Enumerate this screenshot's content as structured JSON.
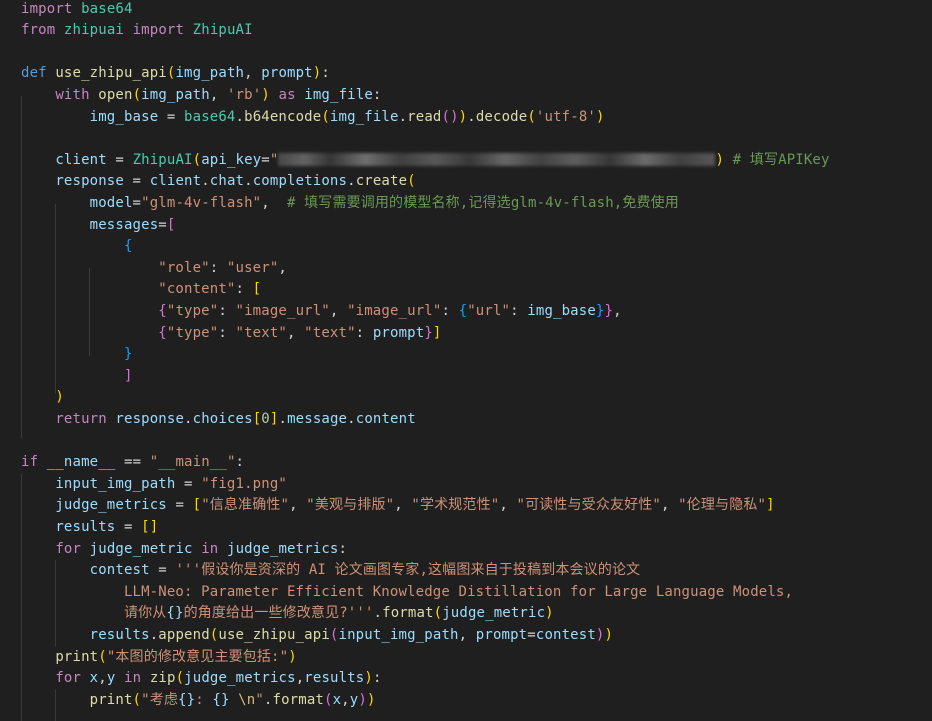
{
  "editor": {
    "language": "python",
    "lines": [
      {
        "tokens": [
          [
            "kw",
            "import"
          ],
          [
            "op",
            " "
          ],
          [
            "cls",
            "base64"
          ]
        ]
      },
      {
        "tokens": [
          [
            "kw",
            "from"
          ],
          [
            "op",
            " "
          ],
          [
            "cls",
            "zhipuai"
          ],
          [
            "op",
            " "
          ],
          [
            "kw",
            "import"
          ],
          [
            "op",
            " "
          ],
          [
            "cls",
            "ZhipuAI"
          ]
        ]
      },
      {
        "tokens": []
      },
      {
        "tokens": [
          [
            "kwb",
            "def"
          ],
          [
            "op",
            " "
          ],
          [
            "fn",
            "use_zhipu_api"
          ],
          [
            "b1",
            "("
          ],
          [
            "var",
            "img_path"
          ],
          [
            "op",
            ", "
          ],
          [
            "var",
            "prompt"
          ],
          [
            "b1",
            ")"
          ],
          [
            "op",
            ":"
          ]
        ]
      },
      {
        "tokens": [
          [
            "op",
            "    "
          ],
          [
            "kw",
            "with"
          ],
          [
            "op",
            " "
          ],
          [
            "fn",
            "open"
          ],
          [
            "b1",
            "("
          ],
          [
            "var",
            "img_path"
          ],
          [
            "op",
            ", "
          ],
          [
            "str",
            "'rb'"
          ],
          [
            "b1",
            ")"
          ],
          [
            "op",
            " "
          ],
          [
            "kw",
            "as"
          ],
          [
            "op",
            " "
          ],
          [
            "var",
            "img_file"
          ],
          [
            "op",
            ":"
          ]
        ]
      },
      {
        "tokens": [
          [
            "op",
            "        "
          ],
          [
            "var",
            "img_base"
          ],
          [
            "op",
            " = "
          ],
          [
            "cls",
            "base64"
          ],
          [
            "op",
            "."
          ],
          [
            "fn",
            "b64encode"
          ],
          [
            "b1",
            "("
          ],
          [
            "var",
            "img_file"
          ],
          [
            "op",
            "."
          ],
          [
            "fn",
            "read"
          ],
          [
            "b2",
            "()"
          ],
          [
            "b1",
            ")"
          ],
          [
            "op",
            "."
          ],
          [
            "fn",
            "decode"
          ],
          [
            "b1",
            "("
          ],
          [
            "str",
            "'utf-8'"
          ],
          [
            "b1",
            ")"
          ]
        ]
      },
      {
        "tokens": []
      },
      {
        "tokens": [
          [
            "op",
            "    "
          ],
          [
            "var",
            "client"
          ],
          [
            "op",
            " = "
          ],
          [
            "cls",
            "ZhipuAI"
          ],
          [
            "b1",
            "("
          ],
          [
            "var",
            "api_key"
          ],
          [
            "op",
            "="
          ],
          [
            "str",
            "\""
          ],
          [
            "blur",
            ""
          ],
          [
            "b1",
            ")"
          ],
          [
            "op",
            " "
          ],
          [
            "cmt",
            "# 填写APIKey"
          ]
        ]
      },
      {
        "tokens": [
          [
            "op",
            "    "
          ],
          [
            "var",
            "response"
          ],
          [
            "op",
            " = "
          ],
          [
            "var",
            "client"
          ],
          [
            "op",
            "."
          ],
          [
            "var",
            "chat"
          ],
          [
            "op",
            "."
          ],
          [
            "var",
            "completions"
          ],
          [
            "op",
            "."
          ],
          [
            "fn",
            "create"
          ],
          [
            "b1",
            "("
          ]
        ]
      },
      {
        "tokens": [
          [
            "op",
            "        "
          ],
          [
            "var",
            "model"
          ],
          [
            "op",
            "="
          ],
          [
            "str",
            "\"glm-4v-flash\""
          ],
          [
            "op",
            ",  "
          ],
          [
            "cmt",
            "# 填写需要调用的模型名称,记得选glm-4v-flash,免费使用"
          ]
        ]
      },
      {
        "tokens": [
          [
            "op",
            "        "
          ],
          [
            "var",
            "messages"
          ],
          [
            "op",
            "="
          ],
          [
            "b2",
            "["
          ]
        ]
      },
      {
        "tokens": [
          [
            "op",
            "            "
          ],
          [
            "b3",
            "{"
          ]
        ]
      },
      {
        "tokens": [
          [
            "op",
            "                "
          ],
          [
            "str",
            "\"role\""
          ],
          [
            "op",
            ": "
          ],
          [
            "str",
            "\"user\""
          ],
          [
            "op",
            ","
          ]
        ]
      },
      {
        "tokens": [
          [
            "op",
            "                "
          ],
          [
            "str",
            "\"content\""
          ],
          [
            "op",
            ": "
          ],
          [
            "b1",
            "["
          ]
        ]
      },
      {
        "tokens": [
          [
            "op",
            "                "
          ],
          [
            "b2",
            "{"
          ],
          [
            "str",
            "\"type\""
          ],
          [
            "op",
            ": "
          ],
          [
            "str",
            "\"image_url\""
          ],
          [
            "op",
            ", "
          ],
          [
            "str",
            "\"image_url\""
          ],
          [
            "op",
            ": "
          ],
          [
            "b3",
            "{"
          ],
          [
            "str",
            "\"url\""
          ],
          [
            "op",
            ": "
          ],
          [
            "var",
            "img_base"
          ],
          [
            "b3",
            "}"
          ],
          [
            "b2",
            "}"
          ],
          [
            "op",
            ","
          ]
        ]
      },
      {
        "tokens": [
          [
            "op",
            "                "
          ],
          [
            "b2",
            "{"
          ],
          [
            "str",
            "\"type\""
          ],
          [
            "op",
            ": "
          ],
          [
            "str",
            "\"text\""
          ],
          [
            "op",
            ", "
          ],
          [
            "str",
            "\"text\""
          ],
          [
            "op",
            ": "
          ],
          [
            "var",
            "prompt"
          ],
          [
            "b2",
            "}"
          ],
          [
            "b1",
            "]"
          ]
        ]
      },
      {
        "tokens": [
          [
            "op",
            "            "
          ],
          [
            "b3",
            "}"
          ]
        ]
      },
      {
        "tokens": [
          [
            "op",
            "            "
          ],
          [
            "b2",
            "]"
          ]
        ]
      },
      {
        "tokens": [
          [
            "op",
            "    "
          ],
          [
            "b1",
            ")"
          ]
        ]
      },
      {
        "tokens": [
          [
            "op",
            "    "
          ],
          [
            "kw",
            "return"
          ],
          [
            "op",
            " "
          ],
          [
            "var",
            "response"
          ],
          [
            "op",
            "."
          ],
          [
            "var",
            "choices"
          ],
          [
            "b1",
            "["
          ],
          [
            "num",
            "0"
          ],
          [
            "b1",
            "]"
          ],
          [
            "op",
            "."
          ],
          [
            "var",
            "message"
          ],
          [
            "op",
            "."
          ],
          [
            "var",
            "content"
          ]
        ]
      },
      {
        "tokens": []
      },
      {
        "tokens": [
          [
            "kw",
            "if"
          ],
          [
            "op",
            " "
          ],
          [
            "var",
            "__name__"
          ],
          [
            "op",
            " == "
          ],
          [
            "str",
            "\"__main__\""
          ],
          [
            "op",
            ":"
          ]
        ]
      },
      {
        "tokens": [
          [
            "op",
            "    "
          ],
          [
            "var",
            "input_img_path"
          ],
          [
            "op",
            " = "
          ],
          [
            "str",
            "\"fig1.png\""
          ]
        ]
      },
      {
        "tokens": [
          [
            "op",
            "    "
          ],
          [
            "var",
            "judge_metrics"
          ],
          [
            "op",
            " = "
          ],
          [
            "b1",
            "["
          ],
          [
            "str",
            "\"信息准确性\""
          ],
          [
            "op",
            ", "
          ],
          [
            "str",
            "\"美观与排版\""
          ],
          [
            "op",
            ", "
          ],
          [
            "str",
            "\"学术规范性\""
          ],
          [
            "op",
            ", "
          ],
          [
            "str",
            "\"可读性与受众友好性\""
          ],
          [
            "op",
            ", "
          ],
          [
            "str",
            "\"伦理与隐私\""
          ],
          [
            "b1",
            "]"
          ]
        ]
      },
      {
        "tokens": [
          [
            "op",
            "    "
          ],
          [
            "var",
            "results"
          ],
          [
            "op",
            " = "
          ],
          [
            "b1",
            "[]"
          ]
        ]
      },
      {
        "tokens": [
          [
            "op",
            "    "
          ],
          [
            "kw",
            "for"
          ],
          [
            "op",
            " "
          ],
          [
            "var",
            "judge_metric"
          ],
          [
            "op",
            " "
          ],
          [
            "kw",
            "in"
          ],
          [
            "op",
            " "
          ],
          [
            "var",
            "judge_metrics"
          ],
          [
            "op",
            ":"
          ]
        ]
      },
      {
        "tokens": [
          [
            "op",
            "        "
          ],
          [
            "var",
            "contest"
          ],
          [
            "op",
            " = "
          ],
          [
            "str",
            "'''假设你是资深的 AI 论文画图专家,这幅图来自于投稿到本会议的论文"
          ]
        ]
      },
      {
        "tokens": [
          [
            "str",
            "            LLM-Neo: Parameter Efficient Knowledge Distillation for Large Language Models,"
          ]
        ]
      },
      {
        "tokens": [
          [
            "str",
            "            请你从"
          ],
          [
            "var",
            "{}"
          ],
          [
            "str",
            "的角度给出一些修改意见?'''"
          ],
          [
            "op",
            "."
          ],
          [
            "fn",
            "format"
          ],
          [
            "b1",
            "("
          ],
          [
            "var",
            "judge_metric"
          ],
          [
            "b1",
            ")"
          ]
        ]
      },
      {
        "tokens": [
          [
            "op",
            "        "
          ],
          [
            "var",
            "results"
          ],
          [
            "op",
            "."
          ],
          [
            "fn",
            "append"
          ],
          [
            "b1",
            "("
          ],
          [
            "fn",
            "use_zhipu_api"
          ],
          [
            "b2",
            "("
          ],
          [
            "var",
            "input_img_path"
          ],
          [
            "op",
            ", "
          ],
          [
            "var",
            "prompt"
          ],
          [
            "op",
            "="
          ],
          [
            "var",
            "contest"
          ],
          [
            "b2",
            ")"
          ],
          [
            "b1",
            ")"
          ]
        ]
      },
      {
        "tokens": [
          [
            "op",
            "    "
          ],
          [
            "fn",
            "print"
          ],
          [
            "b1",
            "("
          ],
          [
            "str",
            "\"本图的修改意见主要包括:\""
          ],
          [
            "b1",
            ")"
          ]
        ]
      },
      {
        "tokens": [
          [
            "op",
            "    "
          ],
          [
            "kw",
            "for"
          ],
          [
            "op",
            " "
          ],
          [
            "var",
            "x"
          ],
          [
            "op",
            ","
          ],
          [
            "var",
            "y"
          ],
          [
            "op",
            " "
          ],
          [
            "kw",
            "in"
          ],
          [
            "op",
            " "
          ],
          [
            "fn",
            "zip"
          ],
          [
            "b1",
            "("
          ],
          [
            "var",
            "judge_metrics"
          ],
          [
            "op",
            ","
          ],
          [
            "var",
            "results"
          ],
          [
            "b1",
            ")"
          ],
          [
            "op",
            ":"
          ]
        ]
      },
      {
        "tokens": [
          [
            "op",
            "        "
          ],
          [
            "fn",
            "print"
          ],
          [
            "b1",
            "("
          ],
          [
            "str",
            "\"考虑"
          ],
          [
            "var",
            "{}"
          ],
          [
            "str",
            ": "
          ],
          [
            "var",
            "{}"
          ],
          [
            "str",
            " "
          ],
          [
            "esc",
            "\\n"
          ],
          [
            "str",
            "\""
          ],
          [
            "op",
            "."
          ],
          [
            "fn",
            "format"
          ],
          [
            "b2",
            "("
          ],
          [
            "var",
            "x"
          ],
          [
            "op",
            ","
          ],
          [
            "var",
            "y"
          ],
          [
            "b2",
            ")"
          ],
          [
            "b1",
            ")"
          ]
        ]
      }
    ]
  }
}
